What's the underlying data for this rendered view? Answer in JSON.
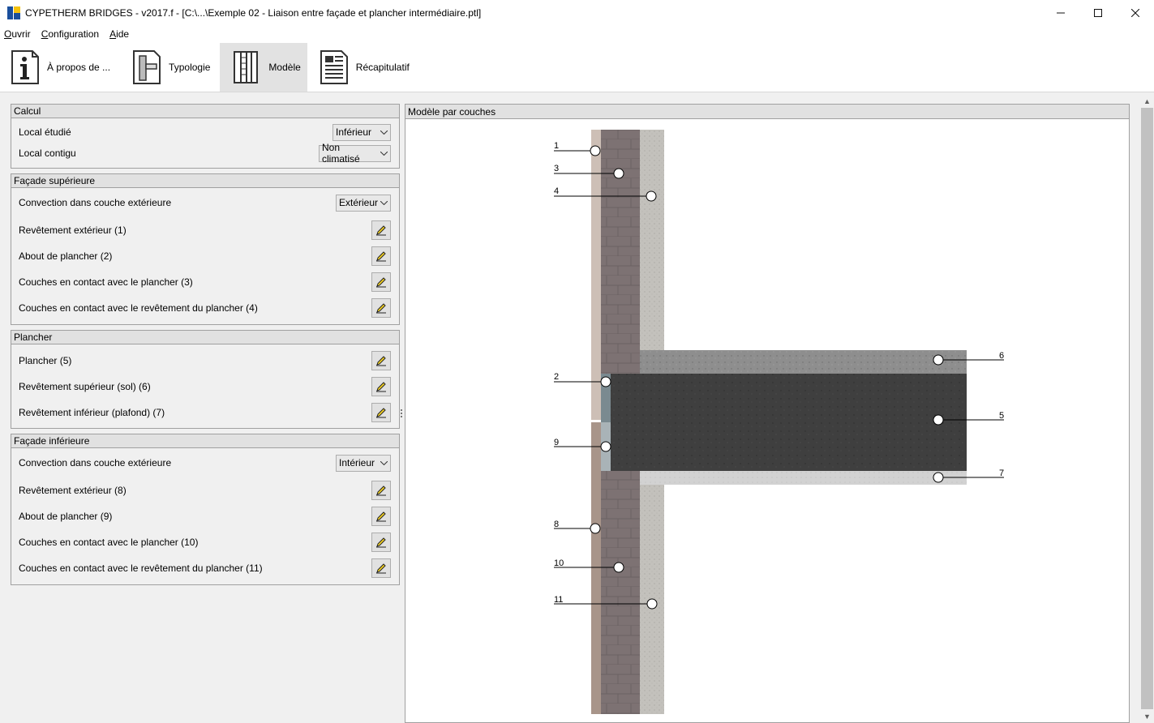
{
  "window": {
    "title": "CYPETHERM BRIDGES - v2017.f - [C:\\...\\Exemple 02 - Liaison entre façade et plancher intermédiaire.ptl]",
    "minimize": "—",
    "maximize": "☐",
    "close": "✕"
  },
  "menu": [
    {
      "key": "O",
      "rest": "uvrir"
    },
    {
      "key": "C",
      "rest": "onfiguration"
    },
    {
      "key": "A",
      "rest": "ide"
    }
  ],
  "toolbar": {
    "items": [
      {
        "label": "À propos de ...",
        "icon": "info-icon"
      },
      {
        "label": "Typologie",
        "icon": "typology-icon"
      },
      {
        "label": "Modèle",
        "icon": "model-icon",
        "active": true
      },
      {
        "label": "Récapitulatif",
        "icon": "summary-icon"
      }
    ]
  },
  "groups": {
    "calcul": {
      "title": "Calcul",
      "local_etudie": {
        "label": "Local étudié",
        "value": "Inférieur"
      },
      "local_contigu": {
        "label": "Local contigu",
        "value": "Non climatisé"
      }
    },
    "facade_sup": {
      "title": "Façade supérieure",
      "convection": {
        "label": "Convection dans couche extérieure",
        "value": "Extérieur"
      },
      "items": [
        "Revêtement extérieur (1)",
        "About de plancher (2)",
        "Couches en contact avec le plancher (3)",
        "Couches en contact avec le revêtement du plancher (4)"
      ]
    },
    "plancher": {
      "title": "Plancher",
      "items": [
        "Plancher (5)",
        "Revêtement supérieur (sol) (6)",
        "Revêtement inférieur (plafond) (7)"
      ]
    },
    "facade_inf": {
      "title": "Façade inférieure",
      "convection": {
        "label": "Convection dans couche extérieure",
        "value": "Intérieur"
      },
      "items": [
        "Revêtement extérieur (8)",
        "About de plancher (9)",
        "Couches en contact avec le plancher (10)",
        "Couches en contact avec le revêtement du plancher (11)"
      ]
    }
  },
  "model": {
    "title": "Modèle par couches",
    "callouts": [
      "1",
      "2",
      "3",
      "4",
      "5",
      "6",
      "7",
      "8",
      "9",
      "10",
      "11"
    ]
  }
}
